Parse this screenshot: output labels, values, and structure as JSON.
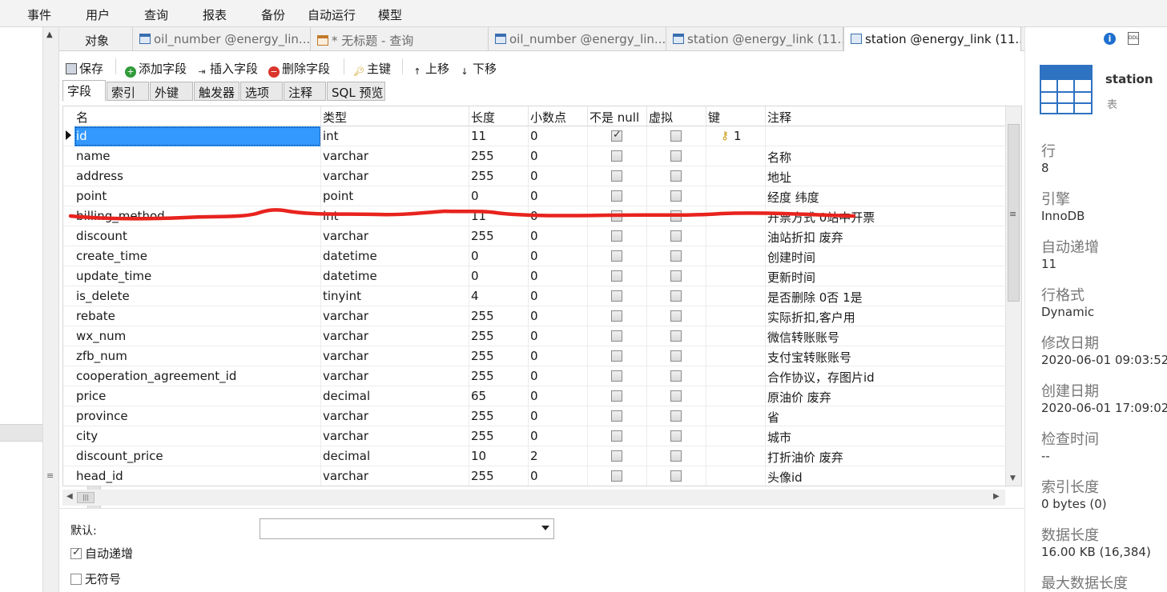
{
  "menu": [
    "事件",
    "用户",
    "查询",
    "报表",
    "备份",
    "自动运行",
    "模型"
  ],
  "left_panel": {
    "tab_label": "对象"
  },
  "tabs": [
    {
      "label": "oil_number @energy_lin...",
      "icon": "table-icon"
    },
    {
      "label": "* 无标题 - 查询",
      "icon": "query-icon"
    },
    {
      "label": "oil_number @energy_lin...",
      "icon": "table-icon"
    },
    {
      "label": "station @energy_link (11...",
      "icon": "table-icon"
    },
    {
      "label": "station @energy_link (11...",
      "icon": "design-table-icon",
      "active": true
    }
  ],
  "toolbar": {
    "save": "保存",
    "add_field": "添加字段",
    "insert_field": "插入字段",
    "delete_field": "删除字段",
    "primary_key": "主键",
    "move_up": "上移",
    "move_down": "下移"
  },
  "subtabs": [
    "字段",
    "索引",
    "外键",
    "触发器",
    "选项",
    "注释",
    "SQL 预览"
  ],
  "grid": {
    "headers": [
      "名",
      "类型",
      "长度",
      "小数点",
      "不是 null",
      "虚拟",
      "键",
      "注释"
    ],
    "rows": [
      {
        "name": "id",
        "type": "int",
        "length": "11",
        "decimals": "0",
        "not_null": true,
        "virtual": false,
        "key": "1",
        "comment": ""
      },
      {
        "name": "name",
        "type": "varchar",
        "length": "255",
        "decimals": "0",
        "not_null": false,
        "virtual": false,
        "key": "",
        "comment": "名称"
      },
      {
        "name": "address",
        "type": "varchar",
        "length": "255",
        "decimals": "0",
        "not_null": false,
        "virtual": false,
        "key": "",
        "comment": "地址"
      },
      {
        "name": "point",
        "type": "point",
        "length": "0",
        "decimals": "0",
        "not_null": false,
        "virtual": false,
        "key": "",
        "comment": "经度 纬度"
      },
      {
        "name": "billing_method",
        "type": "int",
        "length": "11",
        "decimals": "0",
        "not_null": false,
        "virtual": false,
        "key": "",
        "comment": "开票方式 0站中开票"
      },
      {
        "name": "discount",
        "type": "varchar",
        "length": "255",
        "decimals": "0",
        "not_null": false,
        "virtual": false,
        "key": "",
        "comment": "油站折扣 废弃"
      },
      {
        "name": "create_time",
        "type": "datetime",
        "length": "0",
        "decimals": "0",
        "not_null": false,
        "virtual": false,
        "key": "",
        "comment": "创建时间"
      },
      {
        "name": "update_time",
        "type": "datetime",
        "length": "0",
        "decimals": "0",
        "not_null": false,
        "virtual": false,
        "key": "",
        "comment": "更新时间"
      },
      {
        "name": "is_delete",
        "type": "tinyint",
        "length": "4",
        "decimals": "0",
        "not_null": false,
        "virtual": false,
        "key": "",
        "comment": "是否删除 0否 1是"
      },
      {
        "name": "rebate",
        "type": "varchar",
        "length": "255",
        "decimals": "0",
        "not_null": false,
        "virtual": false,
        "key": "",
        "comment": "实际折扣,客户用"
      },
      {
        "name": "wx_num",
        "type": "varchar",
        "length": "255",
        "decimals": "0",
        "not_null": false,
        "virtual": false,
        "key": "",
        "comment": "微信转账账号"
      },
      {
        "name": "zfb_num",
        "type": "varchar",
        "length": "255",
        "decimals": "0",
        "not_null": false,
        "virtual": false,
        "key": "",
        "comment": "支付宝转账账号"
      },
      {
        "name": "cooperation_agreement_id",
        "type": "varchar",
        "length": "255",
        "decimals": "0",
        "not_null": false,
        "virtual": false,
        "key": "",
        "comment": "合作协议，存图片id"
      },
      {
        "name": "price",
        "type": "decimal",
        "length": "65",
        "decimals": "0",
        "not_null": false,
        "virtual": false,
        "key": "",
        "comment": "原油价  废弃"
      },
      {
        "name": "province",
        "type": "varchar",
        "length": "255",
        "decimals": "0",
        "not_null": false,
        "virtual": false,
        "key": "",
        "comment": "省"
      },
      {
        "name": "city",
        "type": "varchar",
        "length": "255",
        "decimals": "0",
        "not_null": false,
        "virtual": false,
        "key": "",
        "comment": "城市"
      },
      {
        "name": "discount_price",
        "type": "decimal",
        "length": "10",
        "decimals": "2",
        "not_null": false,
        "virtual": false,
        "key": "",
        "comment": "打折油价  废弃"
      },
      {
        "name": "head_id",
        "type": "varchar",
        "length": "255",
        "decimals": "0",
        "not_null": false,
        "virtual": false,
        "key": "",
        "comment": "头像id"
      }
    ]
  },
  "bottom": {
    "default_label": "默认:",
    "default_value": "",
    "auto_increment_label": "自动递增",
    "auto_increment_checked": true,
    "unsigned_label": "无符号",
    "unsigned_checked": false
  },
  "info_panel": {
    "ddl_icon_text": "DDL",
    "object_name": "station",
    "object_type": "表",
    "props": [
      {
        "label": "行",
        "value": "8"
      },
      {
        "label": "引擎",
        "value": "InnoDB"
      },
      {
        "label": "自动递增",
        "value": "11"
      },
      {
        "label": "行格式",
        "value": "Dynamic"
      },
      {
        "label": "修改日期",
        "value": "2020-06-01 09:03:52"
      },
      {
        "label": "创建日期",
        "value": "2020-06-01 17:09:02"
      },
      {
        "label": "检查时间",
        "value": "--"
      },
      {
        "label": "索引长度",
        "value": "0 bytes (0)"
      },
      {
        "label": "数据长度",
        "value": "16.00 KB (16,384)"
      },
      {
        "label": "最大数据长度",
        "value": ""
      }
    ]
  },
  "colors": {
    "selection": "#3399ff",
    "accent_blue": "#2e72c2",
    "annotation_red": "#e8231e",
    "key_gold": "#c99a13"
  }
}
